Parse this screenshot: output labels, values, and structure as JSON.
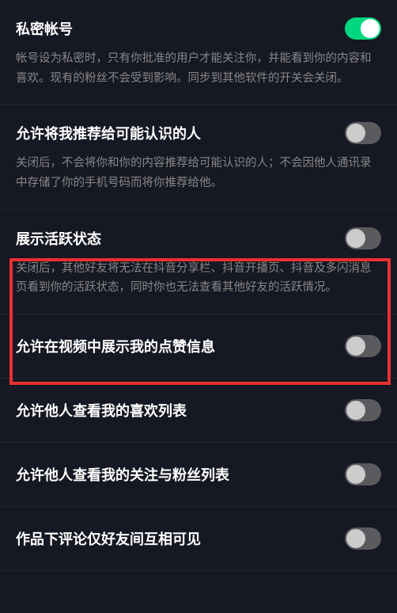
{
  "items": [
    {
      "title": "私密帐号",
      "desc": "帐号设为私密时，只有你批准的用户才能关注你，并能看到你的内容和喜欢。现有的粉丝不会受到影响。同步到其他软件的开关会关闭。",
      "on": true,
      "name": "private-account"
    },
    {
      "title": "允许将我推荐给可能认识的人",
      "desc": "关闭后，不会将你和你的内容推荐给可能认识的人；不会因他人通讯录中存储了你的手机号码而将你推荐给他。",
      "on": false,
      "name": "recommend-to-known"
    },
    {
      "title": "展示活跃状态",
      "desc": "关闭后，其他好友将无法在抖音分享栏、抖音开播页、抖音及多闪消息页看到你的活跃状态，同时你也无法查看其他好友的活跃情况。",
      "on": false,
      "name": "show-active-status",
      "highlighted": true
    },
    {
      "title": "允许在视频中展示我的点赞信息",
      "desc": "",
      "on": false,
      "name": "show-likes-in-video"
    },
    {
      "title": "允许他人查看我的喜欢列表",
      "desc": "",
      "on": false,
      "name": "allow-view-likes-list"
    },
    {
      "title": "允许他人查看我的关注与粉丝列表",
      "desc": "",
      "on": false,
      "name": "allow-view-follow-fans"
    },
    {
      "title": "作品下评论仅好友间互相可见",
      "desc": "",
      "on": false,
      "name": "comments-friends-only"
    }
  ]
}
